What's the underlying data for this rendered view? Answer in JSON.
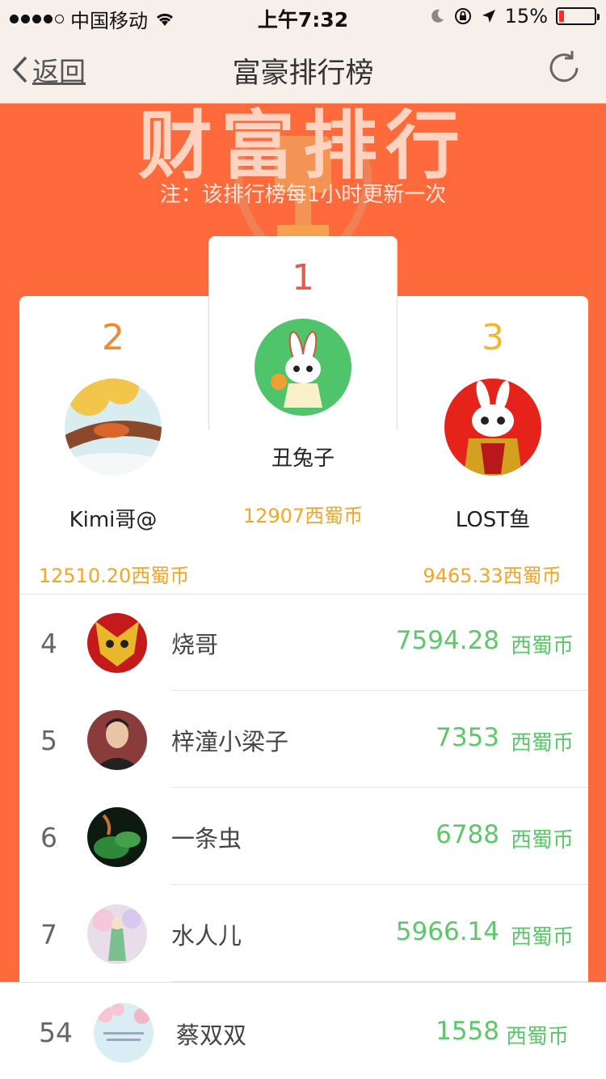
{
  "status_bar": {
    "carrier": "中国移动",
    "time": "上午7:32",
    "battery_text": "15%",
    "battery_level": 0.15
  },
  "nav": {
    "back_label": "返回",
    "title": "富豪排行榜"
  },
  "banner": {
    "title": "财富排行",
    "note": "注：该排行榜每1小时更新一次"
  },
  "podium": {
    "first": {
      "rank": "1",
      "name": "丑兔子",
      "coins": "12907西蜀币",
      "rank_color": "#e35d4e"
    },
    "second": {
      "rank": "2",
      "name": "Kimi哥@",
      "coins": "12510.20西蜀币",
      "rank_color": "#f0882c"
    },
    "third": {
      "rank": "3",
      "name": "LOST鱼",
      "coins": "9465.33西蜀币",
      "rank_color": "#f4b62a"
    }
  },
  "list": [
    {
      "rank": "4",
      "name": "烧哥",
      "amount": "7594.28",
      "unit": "西蜀币"
    },
    {
      "rank": "5",
      "name": "梓潼小梁子",
      "amount": "7353",
      "unit": "西蜀币"
    },
    {
      "rank": "6",
      "name": "一条虫",
      "amount": "6788",
      "unit": "西蜀币"
    },
    {
      "rank": "7",
      "name": "水人儿",
      "amount": "5966.14",
      "unit": "西蜀币"
    }
  ],
  "my_rank": {
    "rank": "54",
    "name": "蔡双双",
    "amount": "1558",
    "unit": "西蜀币"
  }
}
